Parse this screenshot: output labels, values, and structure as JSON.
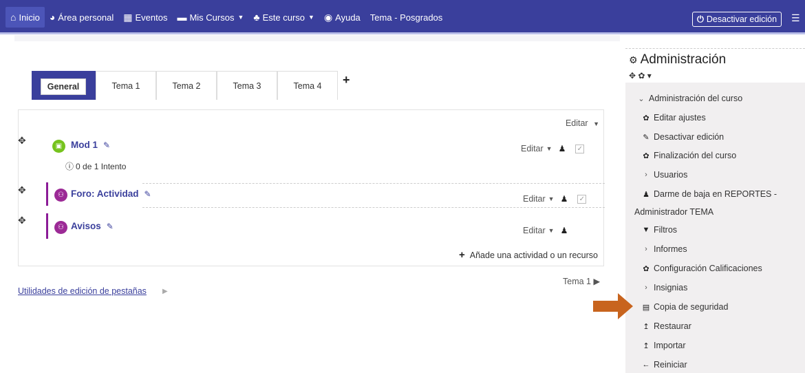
{
  "nav": {
    "items": [
      {
        "icon": "home-icon",
        "glyph": "⌂",
        "label": "Inicio",
        "caret": false
      },
      {
        "icon": "dashboard-icon",
        "glyph": "◕",
        "label": "Área personal",
        "caret": false
      },
      {
        "icon": "calendar-icon",
        "glyph": "▦",
        "label": "Eventos",
        "caret": false
      },
      {
        "icon": "briefcase-icon",
        "glyph": "▬",
        "label": "Mis Cursos",
        "caret": true
      },
      {
        "icon": "sitemap-icon",
        "glyph": "♣",
        "label": "Este curso",
        "caret": true
      },
      {
        "icon": "lifering-icon",
        "glyph": "◉",
        "label": "Ayuda",
        "caret": false
      },
      {
        "icon": "",
        "glyph": "",
        "label": "Tema - Posgrados",
        "caret": false
      }
    ],
    "deactivate_label": "Desactivar edición",
    "power_glyph": "⏻"
  },
  "tabs": {
    "items": [
      "General",
      "Tema 1",
      "Tema 2",
      "Tema 3",
      "Tema 4"
    ],
    "add_glyph": "+"
  },
  "section": {
    "edit_label": "Editar",
    "activities": [
      {
        "name": "Mod 1",
        "type": "scorm",
        "color": "#76c31e",
        "glyph": "▣",
        "attempts": "0 de 1 Intento",
        "has_check": true
      },
      {
        "name": "Foro: Actividad",
        "type": "forum",
        "color": "#9c2a96",
        "glyph": "⚇",
        "has_check": true
      },
      {
        "name": "Avisos",
        "type": "forum",
        "color": "#9c2a96",
        "glyph": "⚇",
        "has_check": false
      }
    ],
    "add_resource_label": "Añade una actividad o un recurso"
  },
  "next_topic": "Tema 1 ▶",
  "utilities_label": "Utilidades de edición de pestañas",
  "sidebar": {
    "title": "Administración",
    "tools": "✥ ✿ ▾",
    "items": [
      {
        "kind": "chev-down",
        "label": "Administración del curso"
      },
      {
        "kind": "icon",
        "icon": "gear-icon",
        "glyph": "✿",
        "label": "Editar ajustes"
      },
      {
        "kind": "icon",
        "icon": "pencil-icon",
        "glyph": "✎",
        "label": "Desactivar edición"
      },
      {
        "kind": "icon",
        "icon": "gear-icon",
        "glyph": "✿",
        "label": "Finalización del curso"
      },
      {
        "kind": "chev-right",
        "label": "Usuarios"
      },
      {
        "kind": "icon",
        "icon": "user-icon",
        "glyph": "♟",
        "label": "Darme de baja en REPORTES -"
      },
      {
        "kind": "text",
        "label": "Administrador TEMA"
      },
      {
        "kind": "icon",
        "icon": "filter-icon",
        "glyph": "▼",
        "label": "Filtros"
      },
      {
        "kind": "chev-right",
        "label": "Informes"
      },
      {
        "kind": "icon",
        "icon": "gear-icon",
        "glyph": "✿",
        "label": "Configuración Calificaciones"
      },
      {
        "kind": "chev-right",
        "label": "Insignias"
      },
      {
        "kind": "icon",
        "icon": "file-archive-icon",
        "glyph": "▤",
        "label": "Copia de seguridad"
      },
      {
        "kind": "icon",
        "icon": "level-up-icon",
        "glyph": "↥",
        "label": "Restaurar"
      },
      {
        "kind": "icon",
        "icon": "level-up-icon",
        "glyph": "↥",
        "label": "Importar"
      },
      {
        "kind": "icon",
        "icon": "arrow-left-icon",
        "glyph": "←",
        "label": "Reiniciar"
      }
    ]
  },
  "colors": {
    "brand": "#3a3f9c",
    "accent_orange": "#c8641e",
    "forum": "#9c2a96",
    "scorm": "#76c31e"
  }
}
